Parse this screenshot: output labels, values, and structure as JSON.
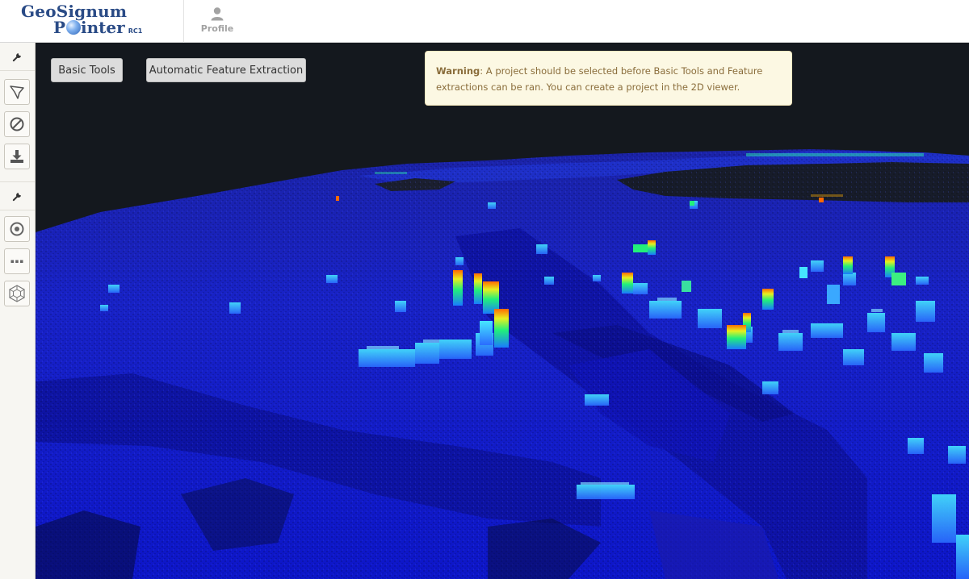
{
  "header": {
    "logo_line1": "GeoSignum",
    "logo_line2": "Pointer",
    "logo_badge": "RC1",
    "profile_label": "Profile",
    "profile_icon": "user-icon"
  },
  "sidebar": {
    "groups": [
      {
        "header_icon": "wrench-icon",
        "items": [
          "polygon-select-icon",
          "clear-icon",
          "download-icon"
        ]
      },
      {
        "header_icon": "wrench-icon",
        "items": [
          "target-icon",
          "more-icon",
          "mesh-icon"
        ]
      }
    ]
  },
  "viewer": {
    "basic_tools_label": "Basic Tools",
    "feature_extraction_label": "Automatic Feature Extraction",
    "warning": {
      "title": "Warning",
      "message": ": A project should be selected before Basic Tools and Feature extractions can be ran. You can create a project in the 2D viewer."
    }
  },
  "colors": {
    "brand": "#2a4b86",
    "sidebar_bg": "#f7f6f2",
    "viewer_bg": "#14181e",
    "warning_bg": "#fcf8e3",
    "warning_text": "#8a6d3b",
    "pointcloud_low": "#0a14d8",
    "pointcloud_high": "#ff6a00"
  }
}
